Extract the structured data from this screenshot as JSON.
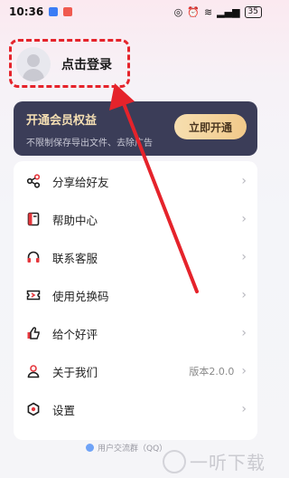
{
  "status_bar": {
    "time": "10:36",
    "battery": "35"
  },
  "profile": {
    "login_label": "点击登录"
  },
  "vip": {
    "title": "开通会员权益",
    "subtitle": "不限制保存导出文件、去除广告",
    "button_label": "立即开通"
  },
  "menu": {
    "items": [
      {
        "label": "分享给好友",
        "icon": "share-icon",
        "value": ""
      },
      {
        "label": "帮助中心",
        "icon": "book-icon",
        "value": ""
      },
      {
        "label": "联系客服",
        "icon": "headset-icon",
        "value": ""
      },
      {
        "label": "使用兑换码",
        "icon": "ticket-icon",
        "value": ""
      },
      {
        "label": "给个好评",
        "icon": "thumbs-up-icon",
        "value": ""
      },
      {
        "label": "关于我们",
        "icon": "user-icon",
        "value": "版本2.0.0"
      },
      {
        "label": "设置",
        "icon": "settings-icon",
        "value": ""
      }
    ]
  },
  "footer": {
    "link_label": "用户交流群（QQ）"
  },
  "watermark": {
    "text": "一听下载"
  },
  "colors": {
    "accent_red": "#e5232b",
    "vip_card_bg": "#3b3d58",
    "vip_gold": "#f1c98a",
    "icon_red": "#e5373d"
  }
}
